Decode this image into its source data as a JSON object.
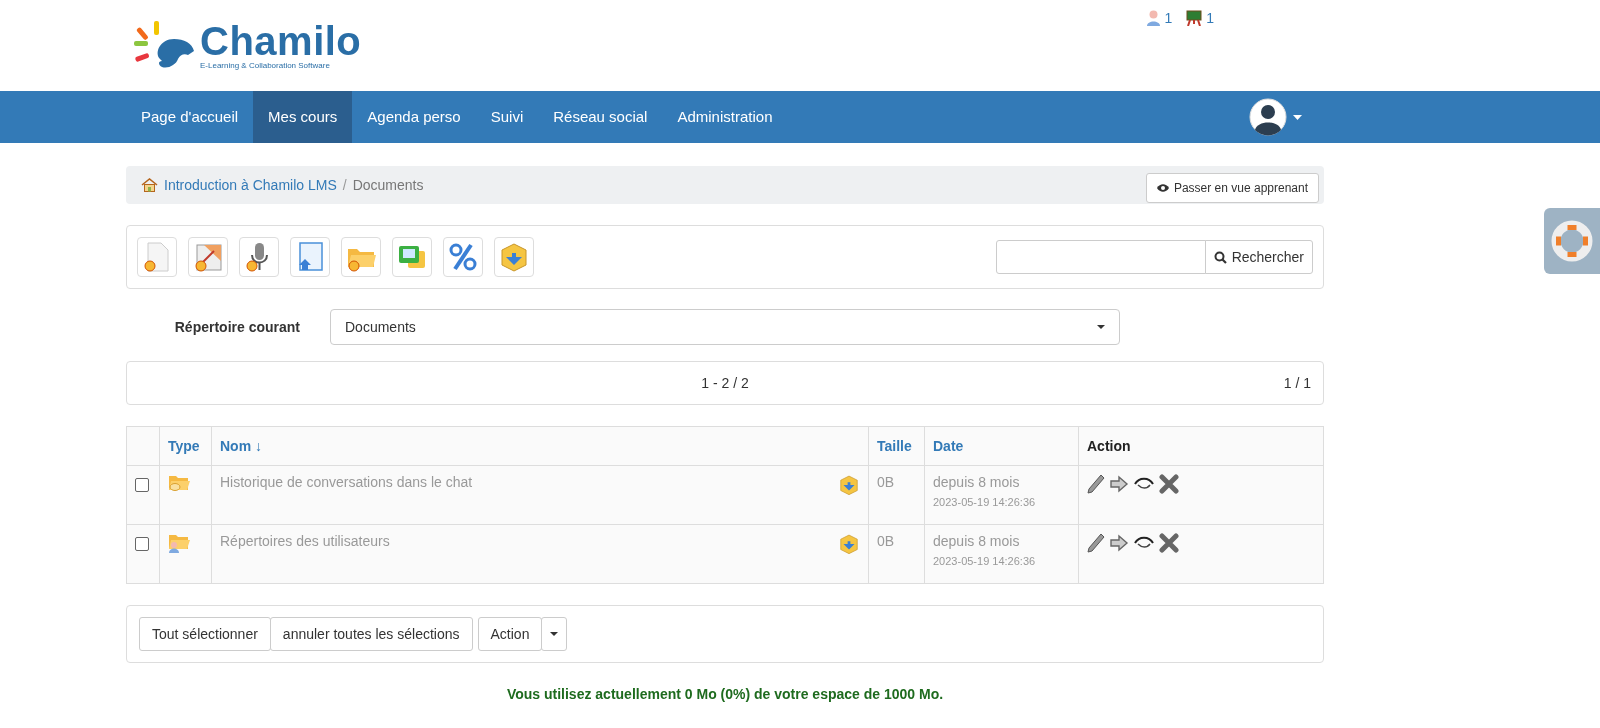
{
  "header": {
    "logo": {
      "name": "Chamilo",
      "tagline": "E-Learning & Collaboration Software"
    },
    "counters": [
      {
        "kind": "users",
        "value": "1"
      },
      {
        "kind": "courses",
        "value": "1"
      }
    ]
  },
  "nav": {
    "items": [
      {
        "label": "Page d'accueil",
        "selected": false
      },
      {
        "label": "Mes cours",
        "selected": true
      },
      {
        "label": "Agenda perso",
        "selected": false
      },
      {
        "label": "Suivi",
        "selected": false
      },
      {
        "label": "Réseau social",
        "selected": false
      },
      {
        "label": "Administration",
        "selected": false
      }
    ]
  },
  "breadcrumb": {
    "items": [
      "Introduction à Chamilo LMS",
      "Documents"
    ],
    "separator": "/",
    "student_view_button": "Passer en vue apprenant"
  },
  "toolbar": {
    "tools": [
      {
        "kind": "new-document"
      },
      {
        "kind": "new-drawing"
      },
      {
        "kind": "record-audio"
      },
      {
        "kind": "upload"
      },
      {
        "kind": "new-folder"
      },
      {
        "kind": "slideshow"
      },
      {
        "kind": "quota"
      },
      {
        "kind": "download"
      }
    ],
    "search_button": "Rechercher"
  },
  "current_folder": {
    "label": "Répertoire courant",
    "value": "Documents"
  },
  "pager": {
    "range": "1 - 2 / 2",
    "page": "1 / 1"
  },
  "table": {
    "columns": [
      {
        "label": "Type",
        "sortable": true
      },
      {
        "label": "Nom ↓",
        "sortable": true
      },
      {
        "label": "Taille",
        "sortable": true
      },
      {
        "label": "Date",
        "sortable": true
      },
      {
        "label": "Action",
        "sortable": false
      }
    ],
    "rows": [
      {
        "checked": false,
        "kind": "chat-folder",
        "name": "Historique de conversations dans le chat",
        "size": "0B",
        "age": "depuis 8 mois",
        "date": "2023-05-19 14:26:36"
      },
      {
        "checked": false,
        "kind": "users-folder",
        "name": "Répertoires des utilisateurs",
        "size": "0B",
        "age": "depuis 8 mois",
        "date": "2023-05-19 14:26:36"
      }
    ]
  },
  "bulk": {
    "select_all": "Tout sélectionner",
    "unselect_all": "annuler toutes les sélections",
    "action": "Action"
  },
  "quota_note": "Vous utilisez actuellement 0 Mo (0%) de votre espace de 1000 Mo."
}
